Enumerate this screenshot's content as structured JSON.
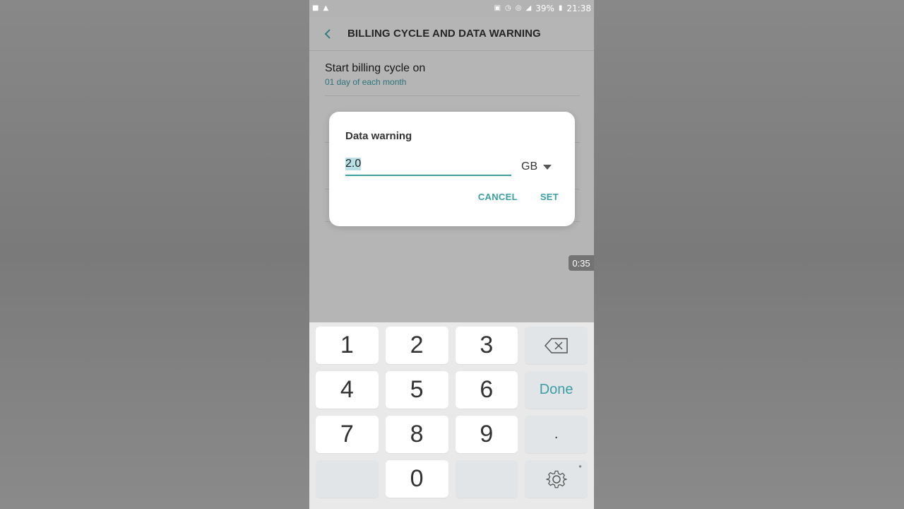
{
  "status_bar": {
    "battery": "39%",
    "time": "21:38"
  },
  "header": {
    "title": "BILLING CYCLE AND DATA WARNING"
  },
  "settings": [
    {
      "title": "Start billing cycle on",
      "subtitle": "01 day of each month"
    }
  ],
  "dialog": {
    "title": "Data warning",
    "input_value": "2.0",
    "unit": "GB",
    "cancel_label": "CANCEL",
    "set_label": "SET"
  },
  "video_timer": "0:35",
  "keyboard": {
    "keys": [
      "1",
      "2",
      "3",
      "4",
      "5",
      "6",
      "7",
      "8",
      "9",
      "0"
    ],
    "done_label": "Done",
    "dot_label": "."
  },
  "colors": {
    "accent": "#3a9ea5",
    "background": "#f4f4f4"
  }
}
